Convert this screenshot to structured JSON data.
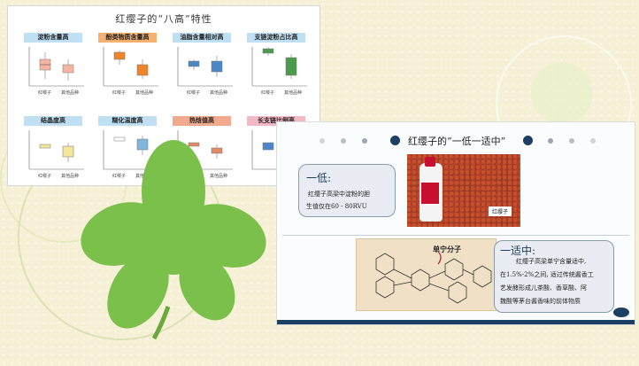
{
  "slide1": {
    "title": "红缨子的“八高”特性",
    "categories": [
      "红缨子",
      "其他品种"
    ],
    "cards": [
      {
        "title": "淀粉含量高",
        "color": "blue"
      },
      {
        "title": "酚类物质含量高",
        "color": "orange"
      },
      {
        "title": "油脂含量相对高",
        "color": "blue"
      },
      {
        "title": "支链淀粉占比高",
        "color": "blue"
      },
      {
        "title": "结晶度高",
        "color": "blue"
      },
      {
        "title": "糊化温度高",
        "color": "blue"
      },
      {
        "title": "热焓值高",
        "color": "salmon"
      },
      {
        "title": "长支链比例高",
        "color": "pink"
      }
    ],
    "colors": {
      "blue": "#bfe0f3",
      "orange": "#f5b16f",
      "salmon": "#f2aa8c",
      "pink": "#f4b9c7"
    }
  },
  "slide2": {
    "title": "红缨子的“一低一适中”",
    "low": {
      "heading": "一低:",
      "line1": "红缨子高梁中淀粉的胆",
      "line2": "生值仅在60 - 80RVU"
    },
    "moderate": {
      "heading": "一适中:",
      "line1": "红缨子高梁单宁含量适中,",
      "line2": "在1.5%-2%之间, 适过传统酱香工",
      "line3": "艺发酵形成儿茶酸、香草酸、阿",
      "line4": "魏酸等茅台酱香味的前体物质"
    },
    "photo_caption": "红缨子",
    "tannin_label": "单宁分子",
    "colors": {
      "navy": "#1c3f63",
      "box_bg": "#e9edf3"
    }
  }
}
